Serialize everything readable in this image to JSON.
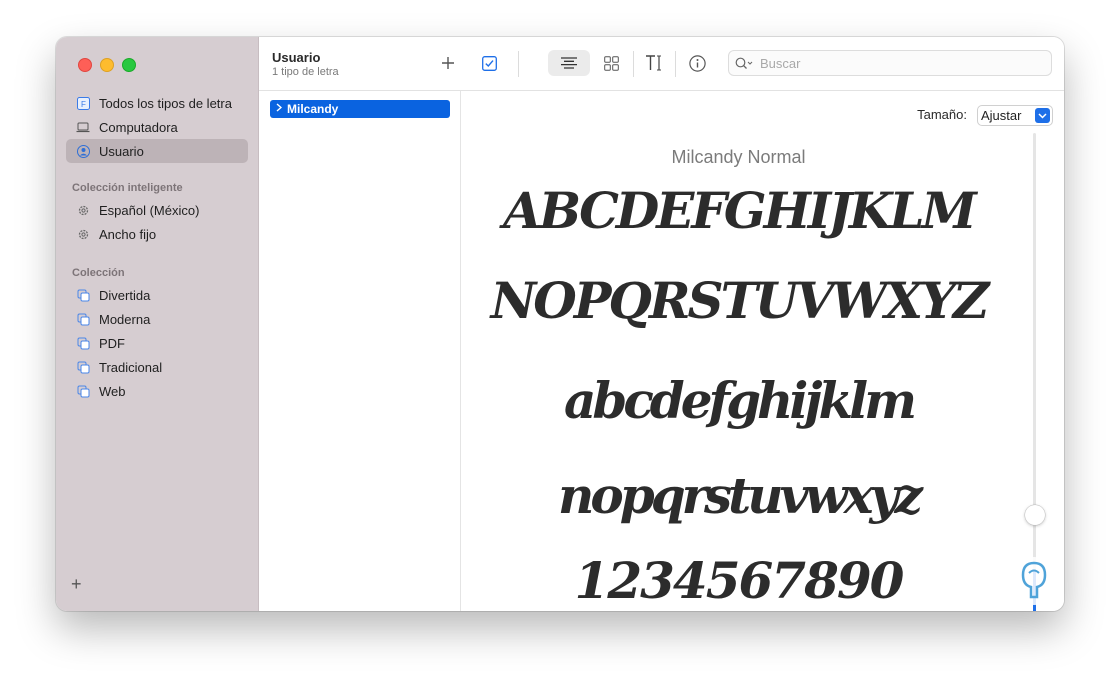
{
  "sidebar": {
    "items": [
      {
        "label": "Todos los tipos de letra",
        "icon": "font-book-icon",
        "active": false
      },
      {
        "label": "Computadora",
        "icon": "laptop-icon",
        "active": false
      },
      {
        "label": "Usuario",
        "icon": "user-icon",
        "active": true
      }
    ],
    "smart_header": "Colección inteligente",
    "smart_items": [
      {
        "label": "Español (México)",
        "icon": "gear-icon"
      },
      {
        "label": "Ancho fijo",
        "icon": "gear-icon"
      }
    ],
    "collection_header": "Colección",
    "collection_items": [
      {
        "label": "Divertida",
        "icon": "collection-icon"
      },
      {
        "label": "Moderna",
        "icon": "collection-icon"
      },
      {
        "label": "PDF",
        "icon": "collection-icon"
      },
      {
        "label": "Tradicional",
        "icon": "collection-icon"
      },
      {
        "label": "Web",
        "icon": "collection-icon"
      }
    ],
    "add_label": "+"
  },
  "toolbar": {
    "title": "Usuario",
    "subtitle": "1 tipo de letra",
    "search_placeholder": "Buscar"
  },
  "font_list": {
    "items": [
      {
        "name": "Milcandy",
        "selected": true
      }
    ]
  },
  "preview": {
    "size_label": "Tamaño:",
    "size_value": "Ajustar",
    "font_name": "Milcandy Normal",
    "samples": {
      "upper1": "ABCDEFGHIJKLM",
      "upper2": "NOPQRSTUVWXYZ",
      "lower1": "abcdefghijklm",
      "lower2": "nopqrstuvwxyz",
      "digits": "1234567890"
    },
    "slider_level": 0.8
  },
  "colors": {
    "accent": "#0a63e0",
    "sidebar_bg": "#d6cdd1"
  }
}
